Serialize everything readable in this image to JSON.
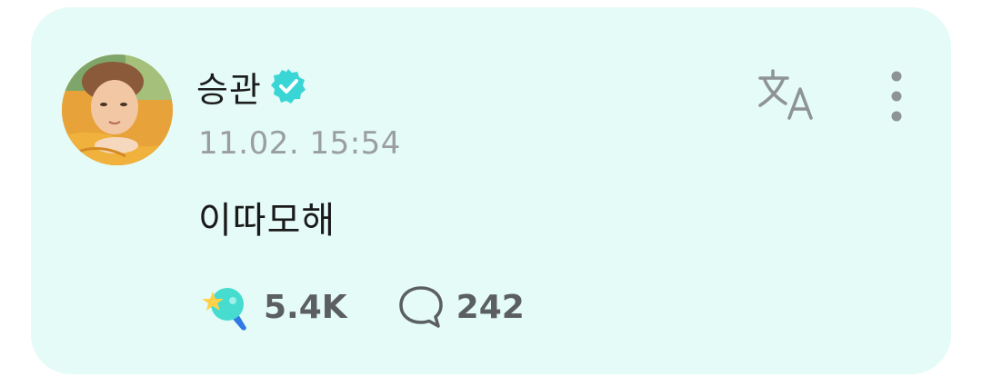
{
  "post": {
    "author_name": "승관",
    "timestamp": "11.02. 15:54",
    "text": "이따모해"
  },
  "stats": {
    "likes": "5.4K",
    "comments": "242"
  },
  "icons": {
    "verified": "verified-badge-icon",
    "translate": "translate-icon",
    "more": "more-vertical-icon",
    "like": "star-lightstick-icon",
    "comment": "speech-bubble-icon"
  },
  "colors": {
    "card_background": "#e4fbf7",
    "verified_badge": "#3ad6d6",
    "timestamp": "#9a9e9f",
    "stat_text": "#5b5f61"
  }
}
